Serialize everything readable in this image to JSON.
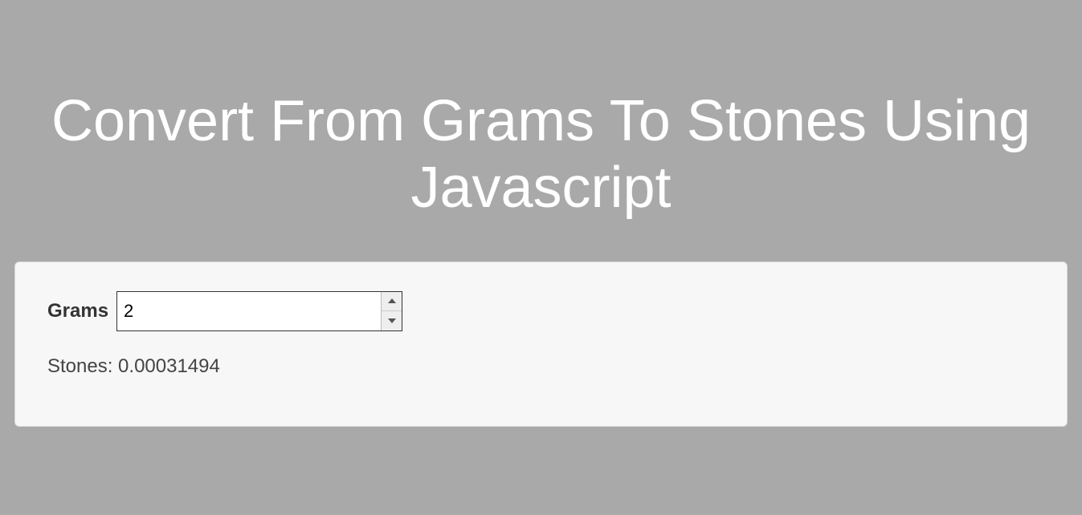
{
  "header": {
    "title": "Convert From Grams To Stones Using Javascript"
  },
  "panel": {
    "grams_label": "Grams",
    "grams_value": "2",
    "result_text": "Stones: 0.00031494"
  }
}
